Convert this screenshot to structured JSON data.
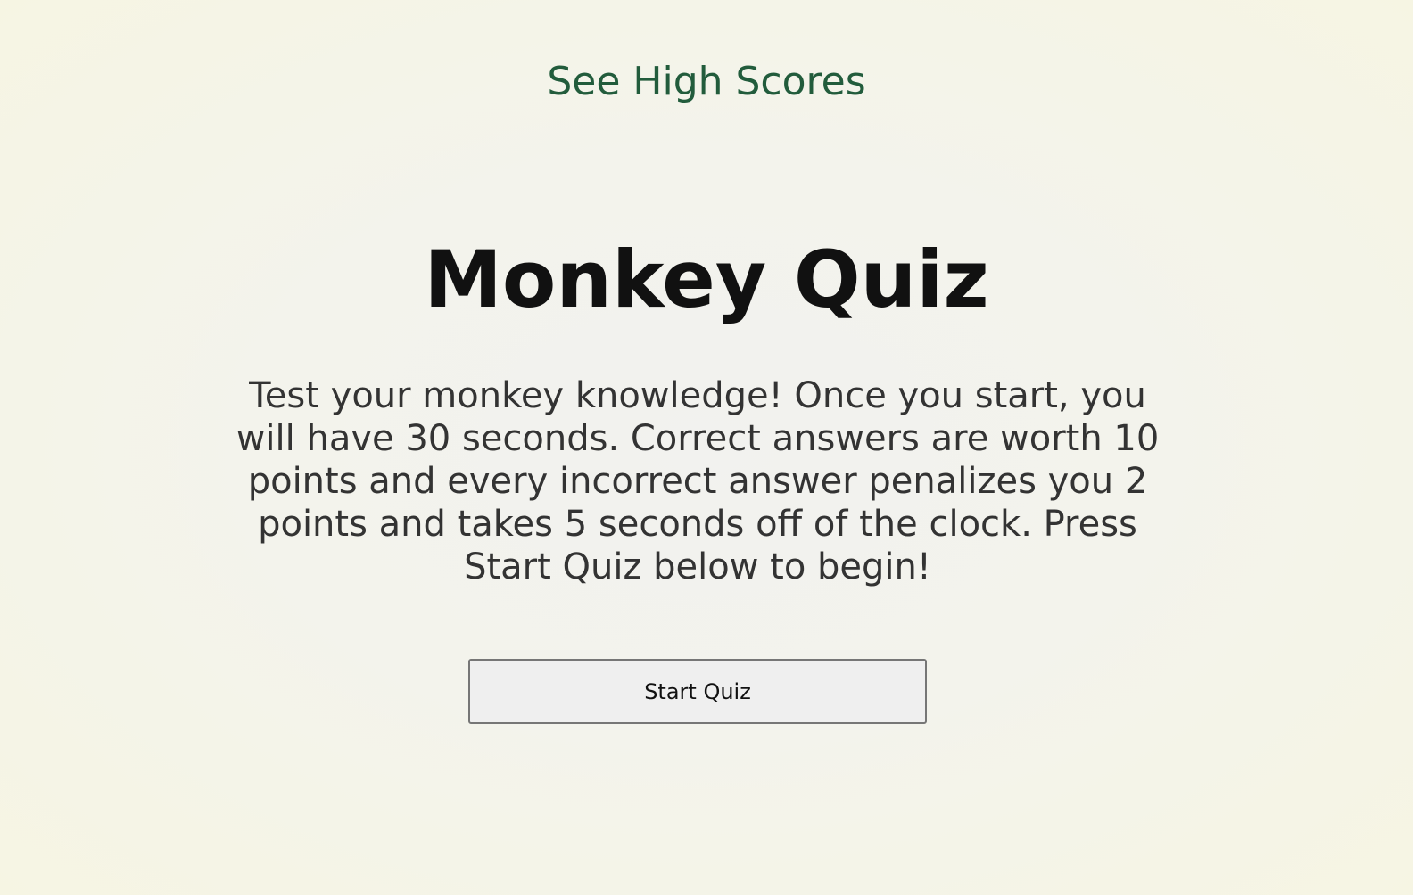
{
  "header": {
    "high_scores_link": "See High Scores"
  },
  "main": {
    "title": "Monkey Quiz",
    "description": "Test your monkey knowledge! Once you start, you will have 30 seconds. Correct answers are worth 10 points and every incorrect answer penalizes you 2 points and takes 5 seconds off of the clock. Press Start Quiz below to begin!",
    "start_button": "Start Quiz"
  }
}
